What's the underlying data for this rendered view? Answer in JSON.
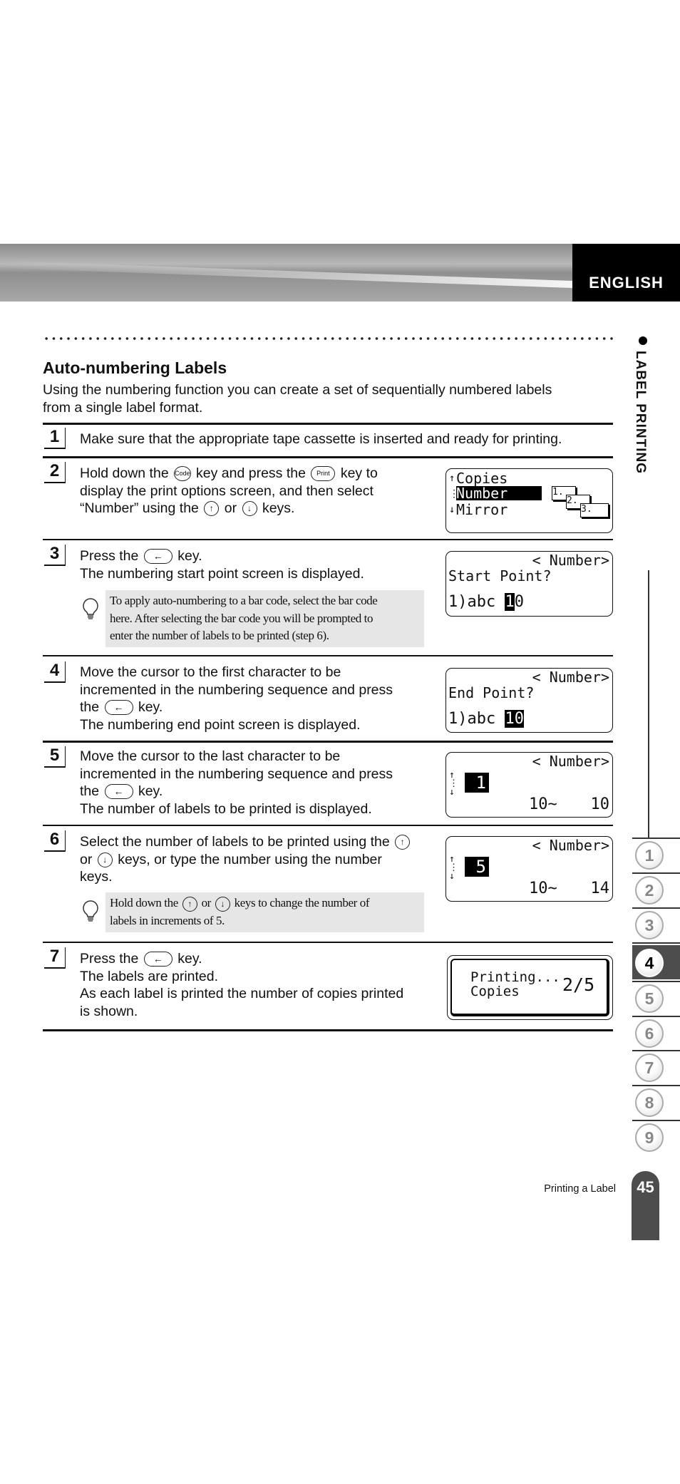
{
  "header": {
    "language": "ENGLISH"
  },
  "section": {
    "side_label": "LABEL PRINTING",
    "title": "Auto-numbering Labels",
    "intro_1": "Using the numbering function you can create a set of sequentially numbered labels",
    "intro_2": "from a single label format."
  },
  "keys": {
    "code": "Code",
    "print": "Print",
    "up": "↑",
    "down": "↓",
    "enter": "←"
  },
  "steps": [
    {
      "n": "1",
      "l1": "Make sure that the appropriate tape cassette is inserted and ready for printing."
    },
    {
      "n": "2",
      "l1a": "Hold down the",
      "l1b": "key and press the",
      "l1c": "key to",
      "l2": "display the print options screen, and then select",
      "l3a": "“Number” using the",
      "l3b": "or",
      "l3c": "keys."
    },
    {
      "n": "3",
      "l1a": "Press the",
      "l1b": "key.",
      "l2": "The numbering start point screen is displayed.",
      "note_1": "To apply auto-numbering to a bar code, select the bar code",
      "note_2": "here. After selecting the bar code you will be prompted to",
      "note_3": "enter the number of labels to be printed (step 6)."
    },
    {
      "n": "4",
      "l1": "Move the cursor to the first character to be",
      "l2": "incremented in the numbering sequence and press",
      "l3a": "the",
      "l3b": "key.",
      "l4": "The numbering end point screen is displayed."
    },
    {
      "n": "5",
      "l1": "Move the cursor to the last character to be",
      "l2": "incremented in the numbering sequence and press",
      "l3a": "the",
      "l3b": "key.",
      "l4": "The number of labels to be printed is displayed."
    },
    {
      "n": "6",
      "l1": "Select the number of labels to be printed using the",
      "l2a": "or",
      "l2b": "keys, or type the number using the number",
      "l3": "keys.",
      "note_1a": "Hold down the",
      "note_1b": "or",
      "note_1c": "keys to change the number of",
      "note_2": "labels in increments of 5."
    },
    {
      "n": "7",
      "l1a": "Press the",
      "l1b": "key.",
      "l2": "The labels are printed.",
      "l3": "As each label is printed the number of copies printed",
      "l4": "is shown."
    }
  ],
  "screens": {
    "s2": {
      "opt1": "Copies",
      "opt2": "Number",
      "opt3": "Mirror",
      "tag1": "1.",
      "tag2": "2.",
      "tag3": "3."
    },
    "s3": {
      "title": "< Number>",
      "prompt": "Start Point?",
      "text": "abc ",
      "cur": "1",
      "rest": "0"
    },
    "s4": {
      "title": "< Number>",
      "prompt": "End Point?",
      "text": "abc ",
      "sel": "10"
    },
    "s5": {
      "title": "< Number>",
      "count": "1",
      "range_start": "10~",
      "range_end": "10"
    },
    "s6": {
      "title": "< Number>",
      "count": "5",
      "range_start": "10~",
      "range_end": "14"
    },
    "s7": {
      "line1": "Printing...",
      "line2": "Copies",
      "progress": "2/5"
    }
  },
  "chapters": {
    "items": [
      "1",
      "2",
      "3",
      "4",
      "5",
      "6",
      "7",
      "8",
      "9"
    ],
    "active": "4"
  },
  "footer": {
    "section": "Printing a Label",
    "page": "45"
  }
}
